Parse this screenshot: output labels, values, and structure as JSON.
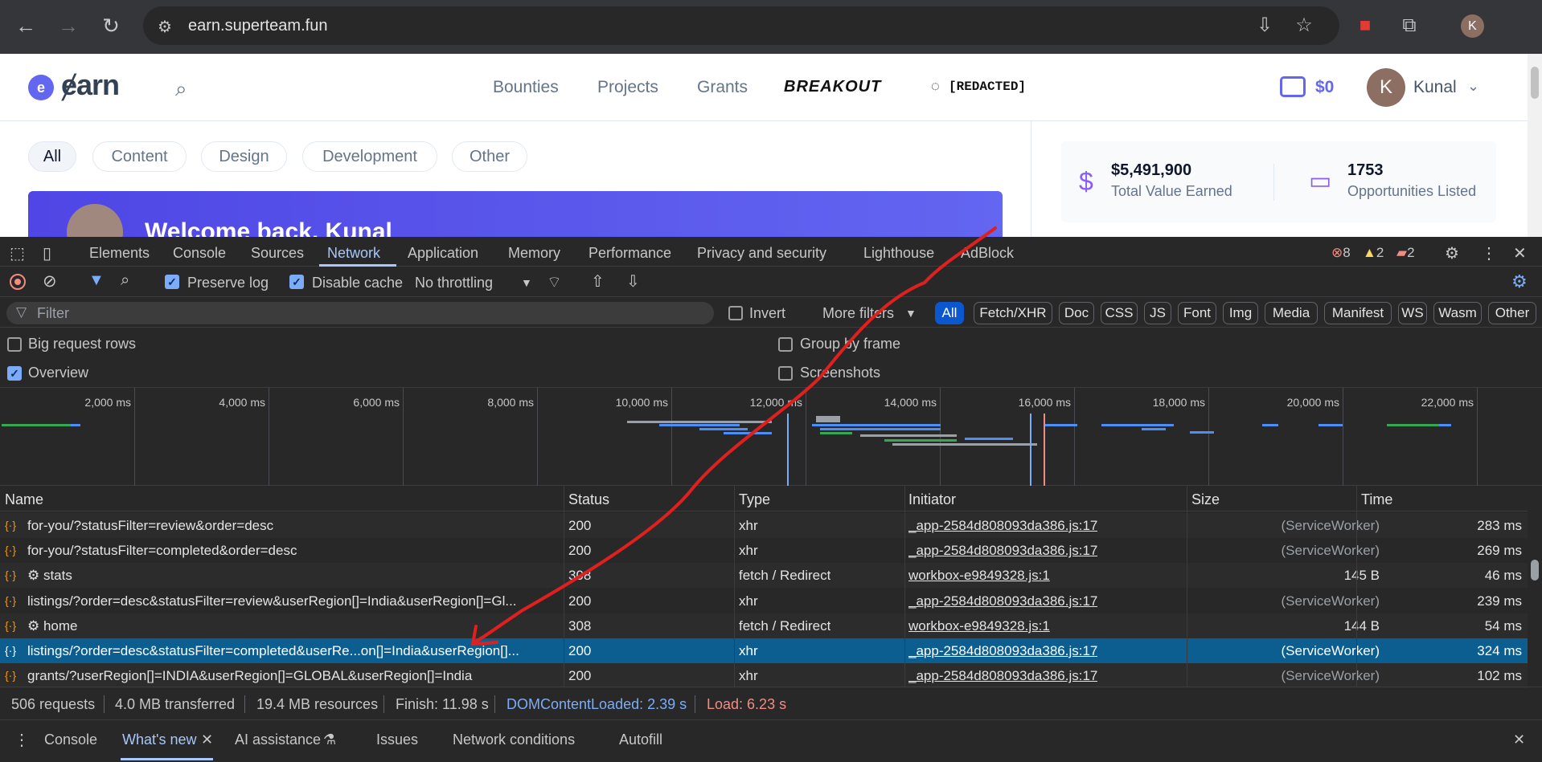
{
  "browser": {
    "url": "earn.superteam.fun",
    "profile_initial": "K"
  },
  "site": {
    "logo_text": "ɇarn",
    "nav": [
      "Bounties",
      "Projects",
      "Grants"
    ],
    "breakout_label": "BREAKOUT",
    "redacted_label": "[REDACTED]",
    "wallet_amount": "$0",
    "user_initial": "K",
    "user_name": "Kunal",
    "categories": [
      "All",
      "Content",
      "Design",
      "Development",
      "Other"
    ],
    "active_category": "All",
    "banner_text": "Welcome back, Kunal",
    "stats": [
      {
        "value": "$5,491,900",
        "label": "Total Value Earned",
        "icon": "dollar-icon"
      },
      {
        "value": "1753",
        "label": "Opportunities Listed",
        "icon": "briefcase-icon"
      }
    ]
  },
  "devtools": {
    "tabs": [
      "Elements",
      "Console",
      "Sources",
      "Network",
      "Application",
      "Memory",
      "Performance",
      "Privacy and security",
      "Lighthouse",
      "AdBlock"
    ],
    "active_tab": "Network",
    "errors": "8",
    "warnings": "2",
    "issues": "2",
    "toolbar": {
      "preserve_log": "Preserve log",
      "disable_cache": "Disable cache",
      "throttling": "No throttling"
    },
    "filter": {
      "placeholder": "Filter",
      "invert": "Invert",
      "more_filters": "More filters",
      "types": [
        "All",
        "Fetch/XHR",
        "Doc",
        "CSS",
        "JS",
        "Font",
        "Img",
        "Media",
        "Manifest",
        "WS",
        "Wasm",
        "Other"
      ]
    },
    "options": {
      "big_request_rows": "Big request rows",
      "overview": "Overview",
      "group_by_frame": "Group by frame",
      "screenshots": "Screenshots"
    },
    "timeline_ticks": [
      "2,000 ms",
      "4,000 ms",
      "6,000 ms",
      "8,000 ms",
      "10,000 ms",
      "12,000 ms",
      "14,000 ms",
      "16,000 ms",
      "18,000 ms",
      "20,000 ms",
      "22,000 ms"
    ],
    "columns": [
      "Name",
      "Status",
      "Type",
      "Initiator",
      "Size",
      "Time"
    ],
    "rows": [
      {
        "name": "for-you/?statusFilter=review&order=desc",
        "status": "200",
        "type": "xhr",
        "initiator": "_app-2584d808093da386.js:17",
        "size": "(ServiceWorker)",
        "time": "283 ms"
      },
      {
        "name": "for-you/?statusFilter=completed&order=desc",
        "status": "200",
        "type": "xhr",
        "initiator": "_app-2584d808093da386.js:17",
        "size": "(ServiceWorker)",
        "time": "269 ms"
      },
      {
        "name": "⚙ stats",
        "status": "308",
        "type": "fetch / Redirect",
        "initiator": "workbox-e9849328.js:1",
        "size": "145 B",
        "time": "46 ms"
      },
      {
        "name": "listings/?order=desc&statusFilter=review&userRegion[]=India&userRegion[]=Gl...",
        "status": "200",
        "type": "xhr",
        "initiator": "_app-2584d808093da386.js:17",
        "size": "(ServiceWorker)",
        "time": "239 ms"
      },
      {
        "name": "⚙ home",
        "status": "308",
        "type": "fetch / Redirect",
        "initiator": "workbox-e9849328.js:1",
        "size": "144 B",
        "time": "54 ms"
      },
      {
        "name": "listings/?order=desc&statusFilter=completed&userRe...on[]=India&userRegion[]...",
        "status": "200",
        "type": "xhr",
        "initiator": "_app-2584d808093da386.js:17",
        "size": "(ServiceWorker)",
        "time": "324 ms"
      },
      {
        "name": "grants/?userRegion[]=INDIA&userRegion[]=GLOBAL&userRegion[]=India",
        "status": "200",
        "type": "xhr",
        "initiator": "_app-2584d808093da386.js:17",
        "size": "(ServiceWorker)",
        "time": "102 ms"
      }
    ],
    "selected_row": 5,
    "summary": {
      "requests": "506 requests",
      "transferred": "4.0 MB transferred",
      "resources": "19.4 MB resources",
      "finish": "Finish: 11.98 s",
      "dcl": "DOMContentLoaded: 2.39 s",
      "load": "Load: 6.23 s"
    },
    "drawer_tabs": [
      "Console",
      "What's new",
      "AI assistance",
      "Issues",
      "Network conditions",
      "Autofill"
    ],
    "active_drawer_tab": "What's new"
  },
  "colors": {
    "accent": "#6366f1",
    "devtools_active": "#a8c7fa",
    "annotation": "#e0201e",
    "dcl": "#7cacf8",
    "load": "#f28b82"
  }
}
